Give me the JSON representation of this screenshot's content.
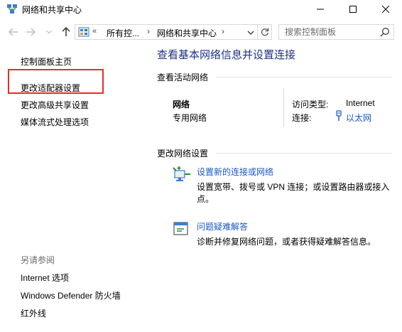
{
  "window": {
    "title": "网络和共享中心",
    "icon": "network-sharing-icon"
  },
  "navigation": {
    "address": {
      "overflow_marker": "«",
      "crumbs": [
        "所有控...",
        "网络和共享中心"
      ]
    },
    "search_placeholder": "搜索控制面板"
  },
  "left_pane": {
    "links": {
      "home": "控制面板主页",
      "adapter_settings": "更改适配器设置",
      "advanced_sharing": "更改高级共享设置",
      "media_streaming": "媒体流式处理选项"
    },
    "see_also": {
      "heading": "另请参阅",
      "items": [
        "Internet 选项",
        "Windows Defender 防火墙",
        "红外线"
      ]
    }
  },
  "main": {
    "title": "查看基本网络信息并设置连接",
    "active_networks": {
      "heading": "查看活动网络",
      "network_name": "网络",
      "network_type": "专用网络",
      "access_type_label": "访问类型:",
      "access_type_value": "Internet",
      "connections_label": "连接:",
      "connection_link": "以太网"
    },
    "change_settings": {
      "heading": "更改网络设置",
      "tasks": [
        {
          "link": "设置新的连接或网络",
          "description": "设置宽带、拨号或 VPN 连接；或设置路由器或接入点。",
          "icon": "new-connection-icon"
        },
        {
          "link": "问题疑难解答",
          "description": "诊断并修复网络问题，或者获得疑难解答信息。",
          "icon": "troubleshoot-icon"
        }
      ]
    }
  },
  "colors": {
    "title_blue": "#1e3287",
    "link_blue": "#1a56c7",
    "highlight_red": "#e0302b",
    "muted_gray": "#6d6d6d"
  }
}
